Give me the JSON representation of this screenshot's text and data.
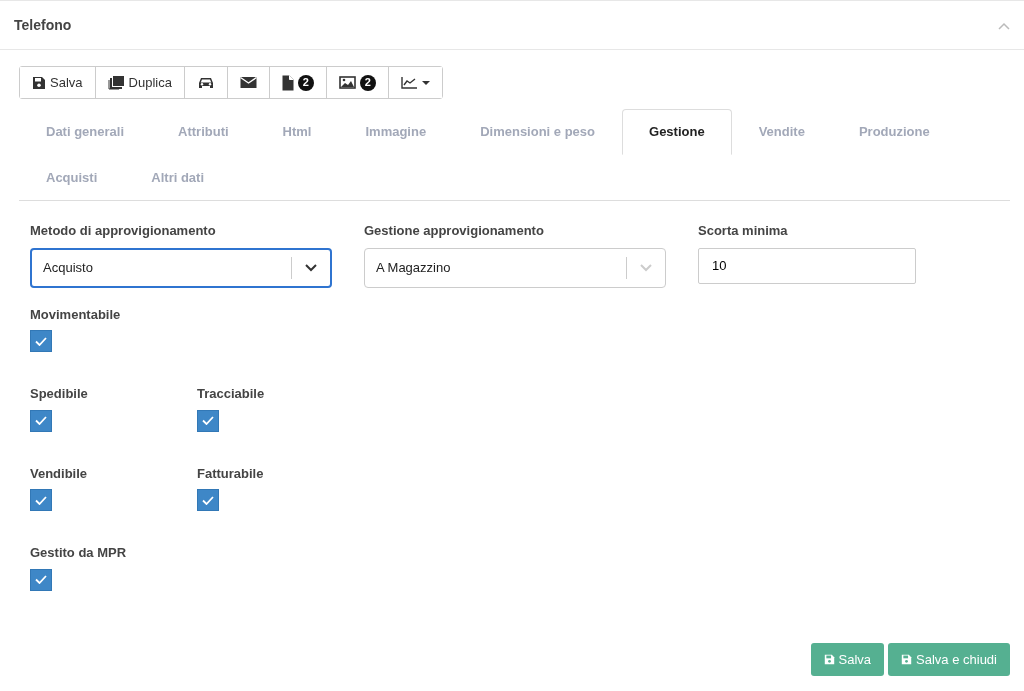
{
  "panel": {
    "title": "Telefono",
    "collapsed": false
  },
  "toolbar": [
    {
      "kind": "save",
      "label": "Salva"
    },
    {
      "kind": "duplicate",
      "label": "Duplica"
    },
    {
      "kind": "car"
    },
    {
      "kind": "mail"
    },
    {
      "kind": "file",
      "badge": "2"
    },
    {
      "kind": "image",
      "badge": "2"
    },
    {
      "kind": "chart",
      "dropdown": true
    }
  ],
  "tabs": [
    {
      "label": "Dati generali",
      "selected": false
    },
    {
      "label": "Attributi",
      "selected": false
    },
    {
      "label": "Html",
      "selected": false
    },
    {
      "label": "Immagine",
      "selected": false
    },
    {
      "label": "Dimensioni e peso",
      "selected": false
    },
    {
      "label": "Gestione",
      "selected": true
    },
    {
      "label": "Vendite",
      "selected": false
    },
    {
      "label": "Produzione",
      "selected": false
    },
    {
      "label": "Acquisti",
      "selected": false
    },
    {
      "label": "Altri dati",
      "selected": false
    }
  ],
  "fields": [
    {
      "kind": "select",
      "label": "Metodo di approvigionamento",
      "value": "Acquisto",
      "focused": true
    },
    {
      "kind": "select",
      "label": "Gestione approvigionamento",
      "value": "A Magazzino",
      "focused": false
    },
    {
      "kind": "input",
      "label": "Scorta minima",
      "value": "10",
      "focused": false
    }
  ],
  "checkbox_rows": [
    [
      {
        "label": "Movimentabile",
        "checked": true
      }
    ],
    [
      {
        "label": "Spedibile",
        "checked": true
      },
      {
        "label": "Tracciabile",
        "checked": true
      }
    ],
    [
      {
        "label": "Vendibile",
        "checked": true
      },
      {
        "label": "Fatturabile",
        "checked": true
      }
    ],
    [
      {
        "label": "Gestito da MPR",
        "checked": true
      }
    ]
  ],
  "footer_buttons": [
    {
      "label": "Salva"
    },
    {
      "label": "Salva e chiudi"
    }
  ]
}
